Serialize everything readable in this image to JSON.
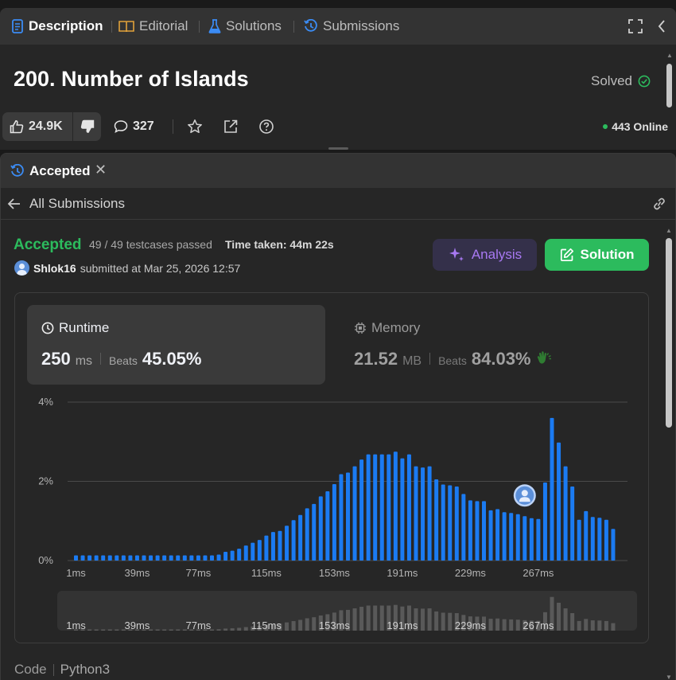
{
  "tabs": {
    "description": "Description",
    "editorial": "Editorial",
    "solutions": "Solutions",
    "submissions": "Submissions"
  },
  "problem": {
    "title": "200. Number of Islands",
    "status": "Solved",
    "likes": "24.9K",
    "comments": "327",
    "online": "443 Online"
  },
  "submission_panel": {
    "tab_label": "Accepted",
    "back_label": "All Submissions",
    "status": "Accepted",
    "testcases": "49 / 49 testcases passed",
    "time_taken": "Time taken: 44m 22s",
    "username": "Shlok16",
    "submitted_at": "submitted at Mar 25, 2026 12:57",
    "analysis_label": "Analysis",
    "solution_label": "Solution",
    "code_label": "Code",
    "language": "Python3"
  },
  "runtime": {
    "label": "Runtime",
    "value": "250",
    "unit": "ms",
    "beats_label": "Beats",
    "beats": "45.05%"
  },
  "memory": {
    "label": "Memory",
    "value": "21.52",
    "unit": "MB",
    "beats_label": "Beats",
    "beats": "84.03%"
  },
  "colors": {
    "accepted": "#2cbb5d",
    "bar": "#1b7bf2",
    "analysis": "#a879f2",
    "mini_bar": "#595959"
  },
  "chart_data": {
    "type": "bar",
    "ylabel": "",
    "xlabel": "",
    "ylim": [
      0,
      4
    ],
    "ytick_labels": [
      "0%",
      "2%",
      "4%"
    ],
    "yticks": [
      0,
      2,
      4
    ],
    "xtick_labels": [
      "1ms",
      "39ms",
      "77ms",
      "115ms",
      "153ms",
      "191ms",
      "229ms",
      "267ms"
    ],
    "xtick_indices": [
      0,
      9,
      18,
      28,
      38,
      48,
      58,
      68
    ],
    "grid": true,
    "user_marker_index": 66,
    "values": [
      0.13,
      0.13,
      0.13,
      0.13,
      0.13,
      0.13,
      0.13,
      0.13,
      0.13,
      0.13,
      0.13,
      0.13,
      0.13,
      0.13,
      0.13,
      0.13,
      0.13,
      0.13,
      0.13,
      0.13,
      0.13,
      0.15,
      0.22,
      0.25,
      0.3,
      0.38,
      0.45,
      0.52,
      0.63,
      0.72,
      0.75,
      0.88,
      1.02,
      1.15,
      1.32,
      1.43,
      1.62,
      1.75,
      1.93,
      2.18,
      2.22,
      2.38,
      2.55,
      2.68,
      2.68,
      2.68,
      2.68,
      2.75,
      2.58,
      2.68,
      2.38,
      2.35,
      2.38,
      2.05,
      1.92,
      1.9,
      1.87,
      1.68,
      1.52,
      1.5,
      1.5,
      1.27,
      1.3,
      1.22,
      1.2,
      1.17,
      1.12,
      1.07,
      1.05,
      1.97,
      3.6,
      2.98,
      2.38,
      1.87,
      1.03,
      1.25,
      1.1,
      1.08,
      1.03,
      0.8
    ]
  }
}
